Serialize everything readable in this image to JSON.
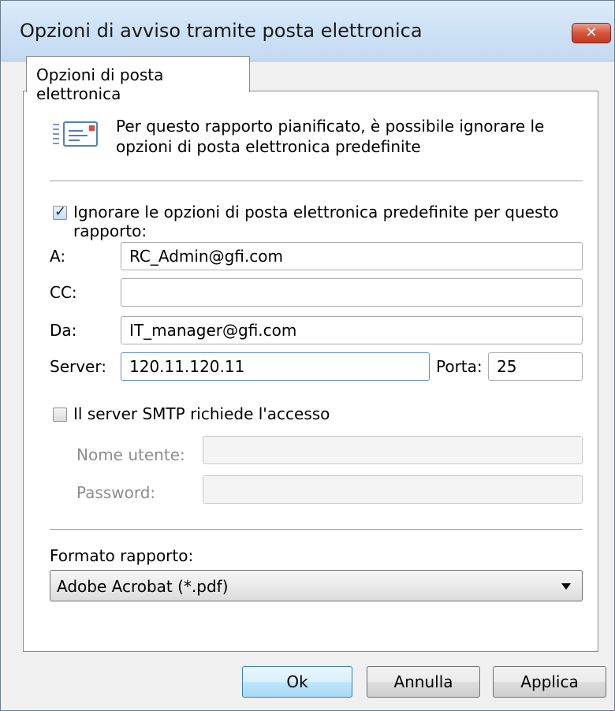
{
  "window": {
    "title": "Opzioni di avviso tramite posta elettronica",
    "close_glyph": "✕"
  },
  "tabs": [
    {
      "label": "Opzioni di posta elettronica",
      "selected": true
    }
  ],
  "info": {
    "icon": "mail-list-icon",
    "text": "Per questo rapporto pianificato, è possibile ignorare le opzioni di posta elettronica predefinite"
  },
  "override": {
    "checked": true,
    "label": "Ignorare le opzioni di posta elettronica predefinite per questo rapporto:"
  },
  "fields": {
    "to": {
      "label": "A:",
      "value": "RC_Admin@gfi.com"
    },
    "cc": {
      "label": "CC:",
      "value": ""
    },
    "from": {
      "label": "Da:",
      "value": "IT_manager@gfi.com"
    },
    "server": {
      "label": "Server:",
      "value": "120.11.120.11"
    },
    "port": {
      "label": "Porta:",
      "value": "25"
    }
  },
  "smtp_auth": {
    "checked": false,
    "label": "Il server SMTP richiede l'accesso",
    "username": {
      "label": "Nome utente:",
      "value": ""
    },
    "password": {
      "label": "Password:",
      "value": ""
    }
  },
  "report_format": {
    "label": "Formato rapporto:",
    "selected": "Adobe Acrobat (*.pdf)"
  },
  "buttons": {
    "ok": "Ok",
    "cancel": "Annulla",
    "apply": "Applica"
  },
  "colors": {
    "titlebar": "#c4daf2",
    "close_button": "#c23a20",
    "default_button_border": "#3c7fb1",
    "focused_field_border": "#5b8ed2"
  }
}
